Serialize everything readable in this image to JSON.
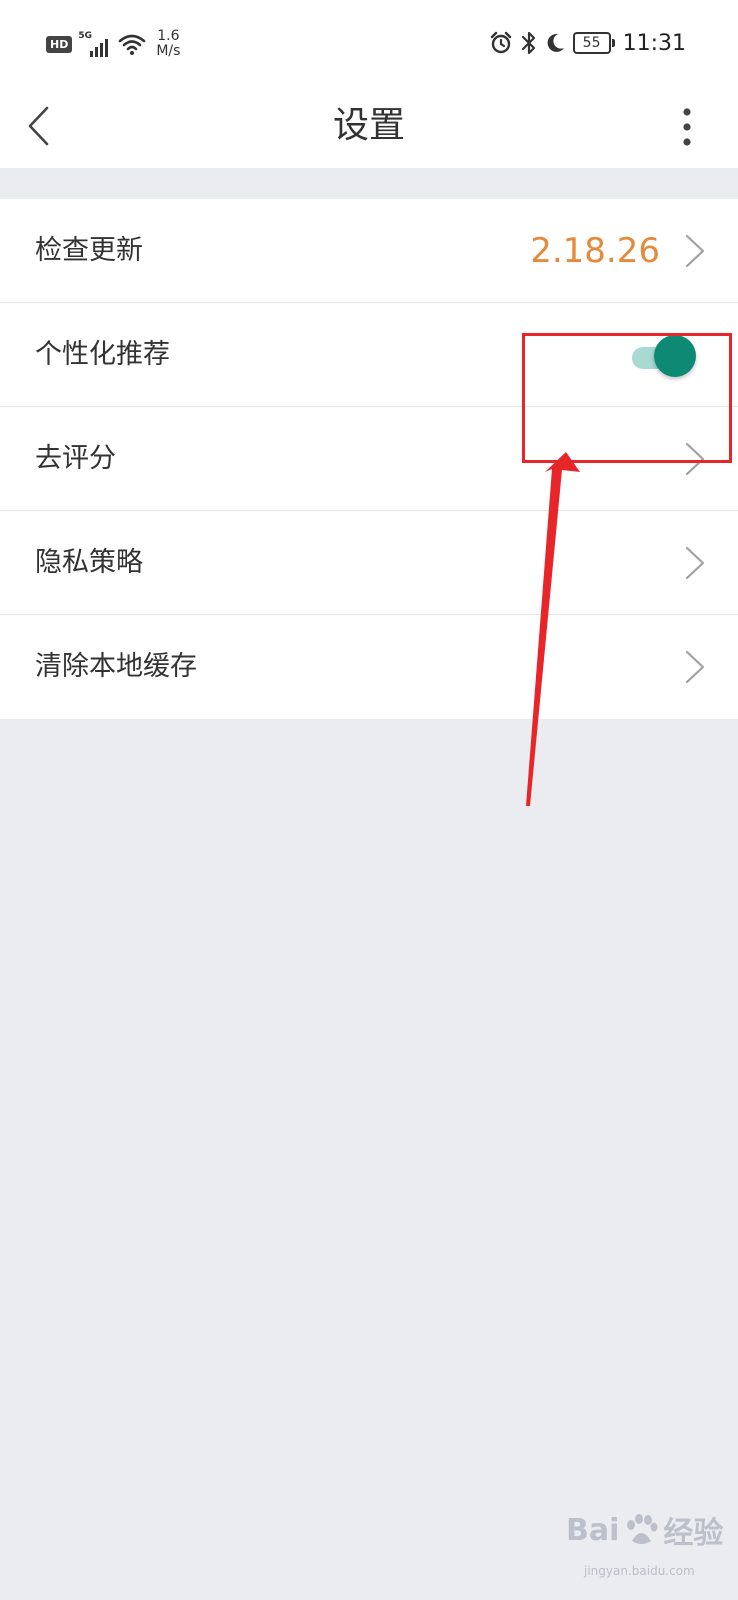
{
  "status_bar": {
    "hd_badge": "HD",
    "network_type": "5G",
    "net_speed_value": "1.6",
    "net_speed_unit": "M/s",
    "battery_level": "55",
    "time": "11:31"
  },
  "nav": {
    "title": "设置"
  },
  "settings": {
    "check_update_label": "检查更新",
    "version": "2.18.26",
    "personalized_label": "个性化推荐",
    "personalized_enabled": true,
    "rate_label": "去评分",
    "privacy_label": "隐私策略",
    "clear_cache_label": "清除本地缓存"
  },
  "colors": {
    "accent_version": "#e58a3a",
    "toggle_on": "#0e8a74",
    "annotation_red": "#e8262a",
    "page_background": "#ebecf0"
  },
  "watermark": {
    "brand": "Bai",
    "brand_cn": "经验",
    "url": "jingyan.baidu.com"
  }
}
